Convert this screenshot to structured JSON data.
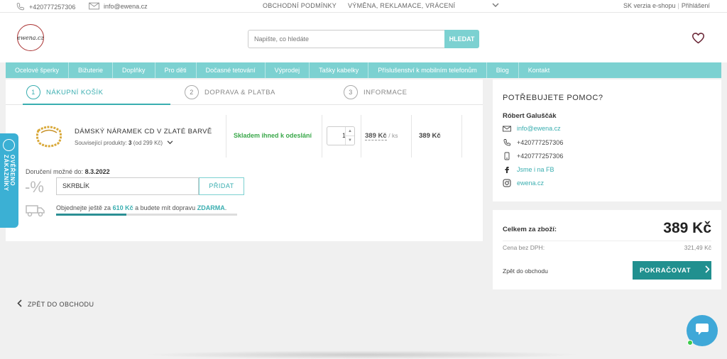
{
  "topbar": {
    "phone": "+420777257306",
    "email": "info@ewena.cz",
    "terms": "OBCHODNÍ PODMÍNKY",
    "returns": "VÝMĚNA, REKLAMACE, VRÁCENÍ",
    "sk_version": "SK verzia e-shopu",
    "separator": "|",
    "login": "Přihlášení"
  },
  "header": {
    "logo_text": "ewena.cz",
    "search_placeholder": "Napište, co hledáte",
    "search_button": "HLEDAT"
  },
  "nav": {
    "items": [
      "Ocelové šperky",
      "Bižuterie",
      "Doplňky",
      "Pro děti",
      "Dočasné tetování",
      "Výprodej",
      "Tašky kabelky",
      "Příslušenství k mobilním telefonům",
      "Blog",
      "Kontakt"
    ]
  },
  "steps": [
    {
      "num": "1",
      "label": "NÁKUPNÍ KOŠÍK"
    },
    {
      "num": "2",
      "label": "DOPRAVA & PLATBA"
    },
    {
      "num": "3",
      "label": "INFORMACE"
    }
  ],
  "cart": {
    "product_name": "DÁMSKÝ NÁRAMEK CD V ZLATÉ BARVĚ",
    "related_label": "Související produkty:",
    "related_count": "3",
    "related_from": "(od 299 Kč)",
    "stock": "Skladem ihned k odeslání",
    "quantity": "1",
    "unit_price": "389 Kč",
    "unit_suffix": "/ ks",
    "total_price": "389 Kč"
  },
  "delivery": {
    "label": "Doručení možné do:",
    "date": "8.3.2022"
  },
  "coupon": {
    "percent_sign": "-%",
    "code": "SKRBLÍK",
    "button": "PŘIDAT"
  },
  "free_shipping": {
    "text_before": "Objednejte ještě za",
    "amount": "610 Kč",
    "text_middle": "a budete mít dopravu",
    "free_word": "ZDARMA",
    "text_end": ".",
    "progress": 0.39
  },
  "help": {
    "title": "POTŘEBUJETE POMOC?",
    "person": "Róbert Galuščák",
    "email": "info@ewena.cz",
    "phone": "+420777257306",
    "mobile": "+420777257306",
    "facebook": "Jsme i na FB",
    "instagram": "ewena.cz"
  },
  "summary": {
    "total_label": "Celkem za zboží:",
    "total_value": "389 Kč",
    "net_label": "Cena bez DPH:",
    "net_value": "321,49 Kč",
    "back_label": "Zpět do obchodu",
    "continue_label": "POKRAČOVAT"
  },
  "back_link": "ZPĚT DO OBCHODU",
  "verified_badge": "OVĚŘENO ZÁKAZNÍKY",
  "colors": {
    "accent": "#7cd1d1",
    "accent_dark": "#21908f",
    "stock_green": "#3aa84a",
    "chat_blue": "#3fa8d8"
  }
}
